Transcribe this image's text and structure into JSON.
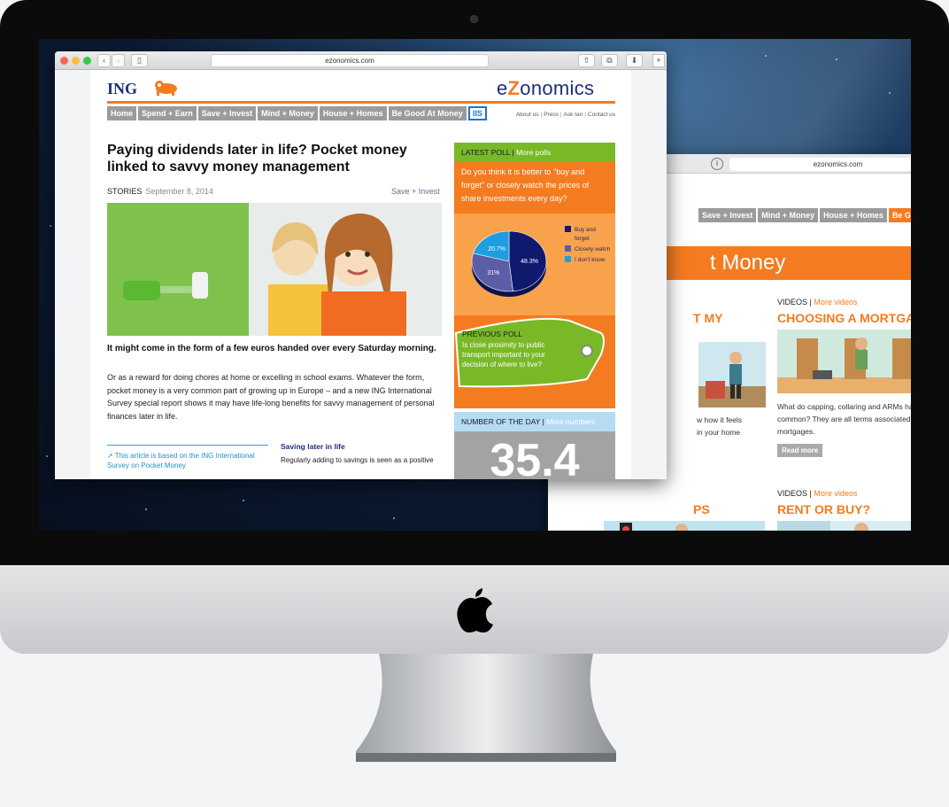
{
  "front": {
    "url": "ezonomics.com",
    "brand": {
      "ing": "ING",
      "ez_pre": "e",
      "ez_z": "Z",
      "ez_post": "onomics"
    },
    "nav": [
      "Home",
      "Spend + Earn",
      "Save + Invest",
      "Mind + Money",
      "House + Homes",
      "Be Good At Money",
      "IIS"
    ],
    "util": [
      "About us",
      "Press",
      "Ask Ian",
      "Contact us"
    ],
    "headline": "Paying dividends later in life? Pocket money linked to savvy money management",
    "meta": {
      "type": "STORIES",
      "date": "September 8, 2014",
      "section": "Save + Invest"
    },
    "lead": "It might come in the form of a few euros handed over every Saturday morning.",
    "body": "Or as a reward for doing chores at home or excelling in school exams. Whatever the form, pocket money is a very common part of growing up in Europe – and a new ING International Survey special report shows it may have life-long benefits for savvy management of personal finances later in life.",
    "related": "This article is based on the ING International Survey on Pocket Money",
    "aside": {
      "title": "Saving later in life",
      "text": "Regularly adding to savings is seen as a positive"
    },
    "poll": {
      "label": "LATEST POLL",
      "more": "More polls",
      "question": "Do you think it is better to \"buy and forget\" or closely watch the prices of share investments every day?",
      "legend": [
        "Buy and forget",
        "Closely watch",
        "I don't know"
      ]
    },
    "previous_poll": {
      "label": "PREVIOUS POLL",
      "question": "Is close proximity to public transport important to your decision of where to live?"
    },
    "number": {
      "label": "NUMBER OF THE DAY",
      "more": "More numbers",
      "value": "35.4"
    }
  },
  "chart_data": {
    "type": "pie",
    "categories": [
      "Buy and forget",
      "Closely watch",
      "I don't know"
    ],
    "values": [
      48.3,
      31,
      20.7
    ],
    "labels": [
      "48.3%",
      "31%",
      "20.7%"
    ],
    "colors": [
      "#0f1a6e",
      "#5b5ea6",
      "#1e9ee0"
    ]
  },
  "back": {
    "url": "ezonomics.com",
    "nav": [
      "Save + Invest",
      "Mind + Money",
      "House + Homes",
      "Be Good At Mo"
    ],
    "banner": "t Money",
    "video1": {
      "label": "VIDEOS",
      "more": "More videos",
      "title": "CHOOSING A MORTGAGE",
      "text": "What do capping, collaring and ARMs have in common? They are all terms associated with mortgages.",
      "button": "Read more"
    },
    "video2": {
      "label": "VIDEOS",
      "more": "More videos",
      "title": "RENT OR BUY?"
    },
    "left_title1": "T MY",
    "left_text1": "w how it feels",
    "left_text2": "in your home",
    "left_title2": "PS"
  },
  "colors": {
    "orange": "#f47b20",
    "navy": "#1e2e7a",
    "green": "#79b928",
    "gray": "#9b9b9b",
    "blue": "#1b74c9"
  }
}
